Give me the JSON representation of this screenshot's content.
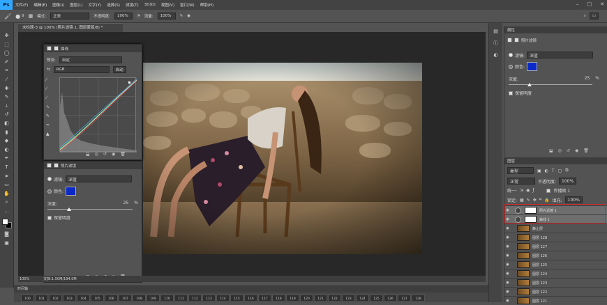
{
  "menubar": {
    "logo": "Ps",
    "items": [
      "文件(F)",
      "编辑(E)",
      "图像(I)",
      "图层(L)",
      "文字(Y)",
      "选择(S)",
      "滤镜(T)",
      "3D(D)",
      "视图(V)",
      "窗口(W)",
      "帮助(H)"
    ]
  },
  "optbar": {
    "brush_size": "9",
    "mode_label": "模式:",
    "mode_value": "正常",
    "opacity_label": "不透明度:",
    "opacity_value": "100%",
    "flow_label": "流量:",
    "flow_value": "100%"
  },
  "doc": {
    "tab_title": "未标题-3 @ 100% (照片滤镜 1, 图层蒙版/8) *",
    "zoom": "100%",
    "doc_info": "文档:1.50M/194.0M"
  },
  "curves": {
    "tab_label": "曲线",
    "preset_label": "预设:",
    "preset_value": "自定",
    "channel_value": "RGB",
    "auto_label": "自动"
  },
  "photofilter": {
    "tab_label": "照片滤镜",
    "filter_label": "滤镜:",
    "filter_value": "深蓝",
    "color_label": "颜色:",
    "density_label": "浓度:",
    "density_value": "25",
    "density_unit": "%",
    "preserve_label": "保留明度",
    "color_hex": "#0b28c9",
    "density_fraction": 0.25
  },
  "properties": {
    "title": "属性",
    "tab_label": "照片滤镜",
    "filter_label": "滤镜:",
    "filter_value": "深蓝",
    "color_label": "颜色:",
    "density_label": "浓度:",
    "density_value": "25",
    "density_unit": "%",
    "preserve_label": "保留明度"
  },
  "layers": {
    "title": "图层",
    "kind_label": "类型",
    "blend_value": "正常",
    "opacity_label": "不透明度:",
    "opacity_value": "100%",
    "unify_label": "统一:",
    "propagate_label": "传播帧 1",
    "lock_label": "锁定:",
    "fill_label": "填充:",
    "fill_value": "100%",
    "rows": [
      {
        "name": "照片滤镜 1",
        "type": "adj"
      },
      {
        "name": "曲线 1",
        "type": "adj"
      },
      {
        "name": "静止层",
        "type": "img"
      },
      {
        "name": "图层 128",
        "type": "img"
      },
      {
        "name": "图层 127",
        "type": "img"
      },
      {
        "name": "图层 126",
        "type": "img"
      },
      {
        "name": "图层 125",
        "type": "img"
      },
      {
        "name": "图层 124",
        "type": "img"
      },
      {
        "name": "图层 123",
        "type": "img"
      },
      {
        "name": "图层 122",
        "type": "img"
      },
      {
        "name": "图层 121",
        "type": "img"
      }
    ]
  },
  "timeline": {
    "title": "时间轴",
    "frames": [
      "100",
      "101",
      "102",
      "103",
      "104",
      "105",
      "106",
      "107",
      "108",
      "109",
      "110",
      "111",
      "112",
      "113",
      "114",
      "115",
      "116",
      "117",
      "118",
      "119",
      "120",
      "121",
      "122",
      "123",
      "124",
      "125",
      "126",
      "127",
      "128"
    ]
  }
}
